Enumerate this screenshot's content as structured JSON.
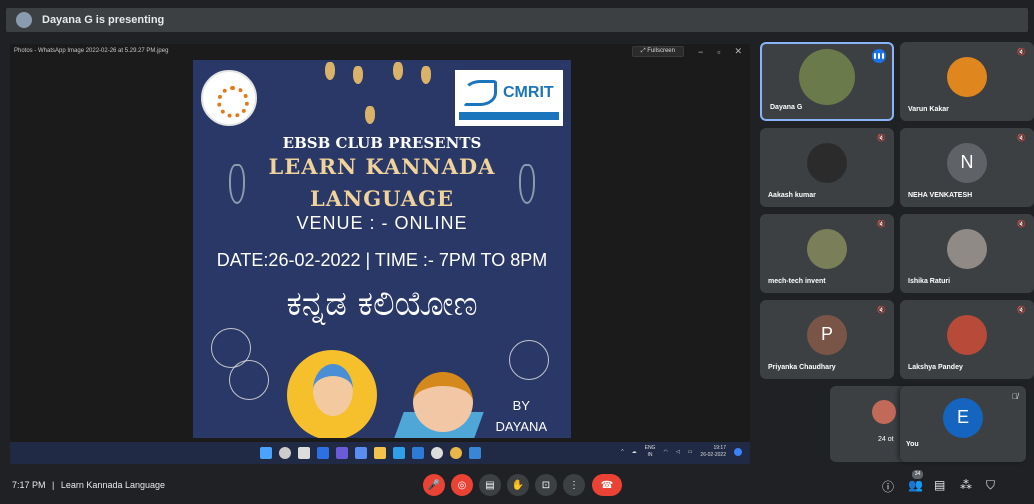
{
  "topbar": {
    "presenting_text": "Dayana G is presenting"
  },
  "share": {
    "window_title": "Photos - WhatsApp Image 2022-02-26 at 5.29.27 PM.jpeg",
    "fullscreen_label": "Fullscreen",
    "poster": {
      "cmrit": "CMRIT",
      "line1": "EBSB CLUB PRESENTS",
      "line2": "LEARN  KANNADA",
      "line3": "LANGUAGE",
      "line4": "VENUE : - ONLINE",
      "line5": "DATE:26-02-2022 | TIME :- 7PM TO 8PM",
      "kannada": "ಕನ್ನಡ ಕಲಿಯೋಣ",
      "by": "BY",
      "author": "DAYANA"
    },
    "taskbar": {
      "lang": "ENG",
      "region": "IN",
      "time": "19:17",
      "date": "26-02-2022"
    }
  },
  "participants": [
    {
      "name": "Dayana G",
      "type": "photo",
      "color": "#6b7a4a",
      "active": true
    },
    {
      "name": "Varun Kakar",
      "type": "photo",
      "color": "#e0861e"
    },
    {
      "name": "Aakash kumar",
      "type": "photo",
      "color": "#2b2b2b"
    },
    {
      "name": "NEHA VENKATESH",
      "type": "letter",
      "letter": "N",
      "color": "#5f6368"
    },
    {
      "name": "mech-tech invent",
      "type": "photo",
      "color": "#7a7f5a"
    },
    {
      "name": "Ishika Raturi",
      "type": "photo",
      "color": "#8f8a86"
    },
    {
      "name": "Priyanka Chaudhary",
      "type": "letter",
      "letter": "P",
      "color": "#795548"
    },
    {
      "name": "Lakshya Pandey",
      "type": "photo",
      "color": "#b84a3a"
    }
  ],
  "others": {
    "count_label": "24 ot"
  },
  "self": {
    "name": "You",
    "letter": "E",
    "color": "#1565c0"
  },
  "bottombar": {
    "time": "7:17 PM",
    "separator": "|",
    "meeting_name": "Learn Kannada Language",
    "participant_count": "34"
  }
}
